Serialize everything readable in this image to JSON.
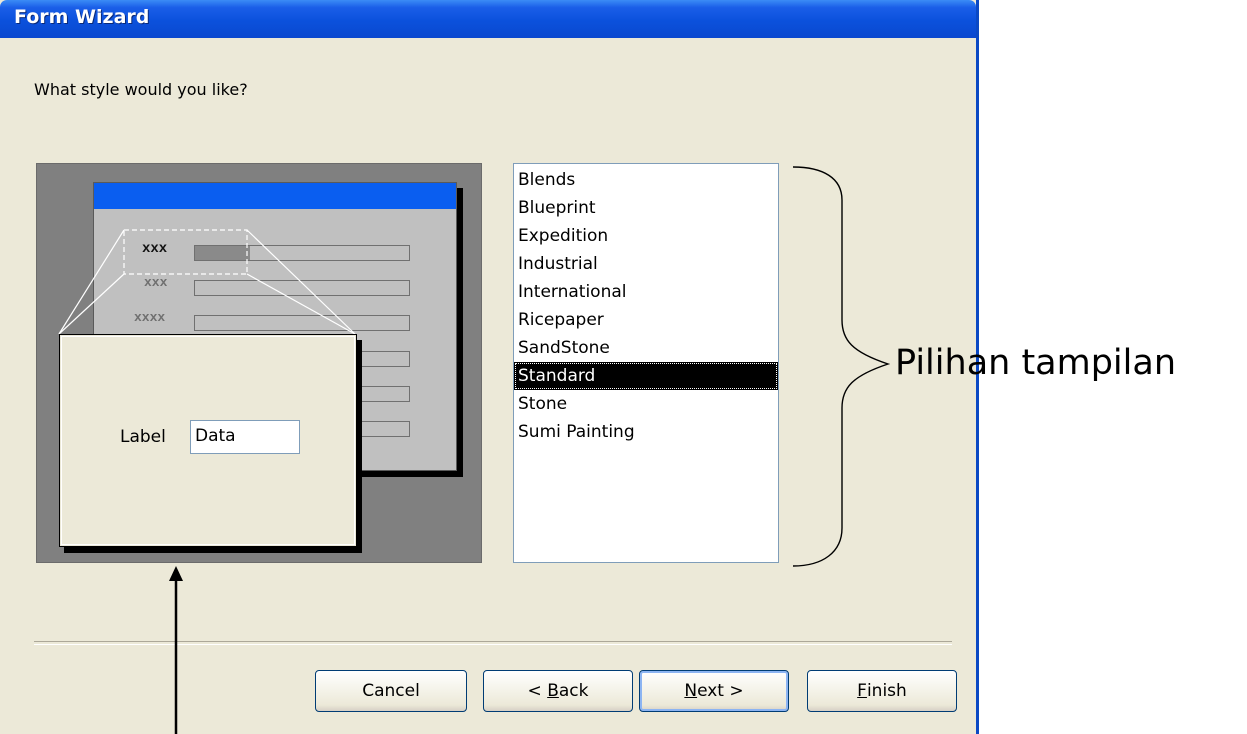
{
  "window": {
    "title": "Form Wizard"
  },
  "prompt": "What style would you like?",
  "preview": {
    "rows": [
      "xxx",
      "xxx",
      "xxxx"
    ],
    "zoom_label": "Label",
    "zoom_field": "Data"
  },
  "style_list": {
    "items": [
      "Blends",
      "Blueprint",
      "Expedition",
      "Industrial",
      "International",
      "Ricepaper",
      "SandStone",
      "Standard",
      "Stone",
      "Sumi Painting"
    ],
    "selected": "Standard"
  },
  "buttons": {
    "cancel": "Cancel",
    "back_prefix": "< ",
    "back_mnemonic": "B",
    "back_rest": "ack",
    "next_mnemonic": "N",
    "next_rest": "ext >",
    "finish_mnemonic": "F",
    "finish_rest": "inish"
  },
  "annotation": {
    "label": "Pilihan tampilan"
  },
  "colors": {
    "titlebar": "#0a48cf",
    "dialog_bg": "#ece9d8",
    "selection": "#000000",
    "form_title": "#0a5ef0"
  }
}
